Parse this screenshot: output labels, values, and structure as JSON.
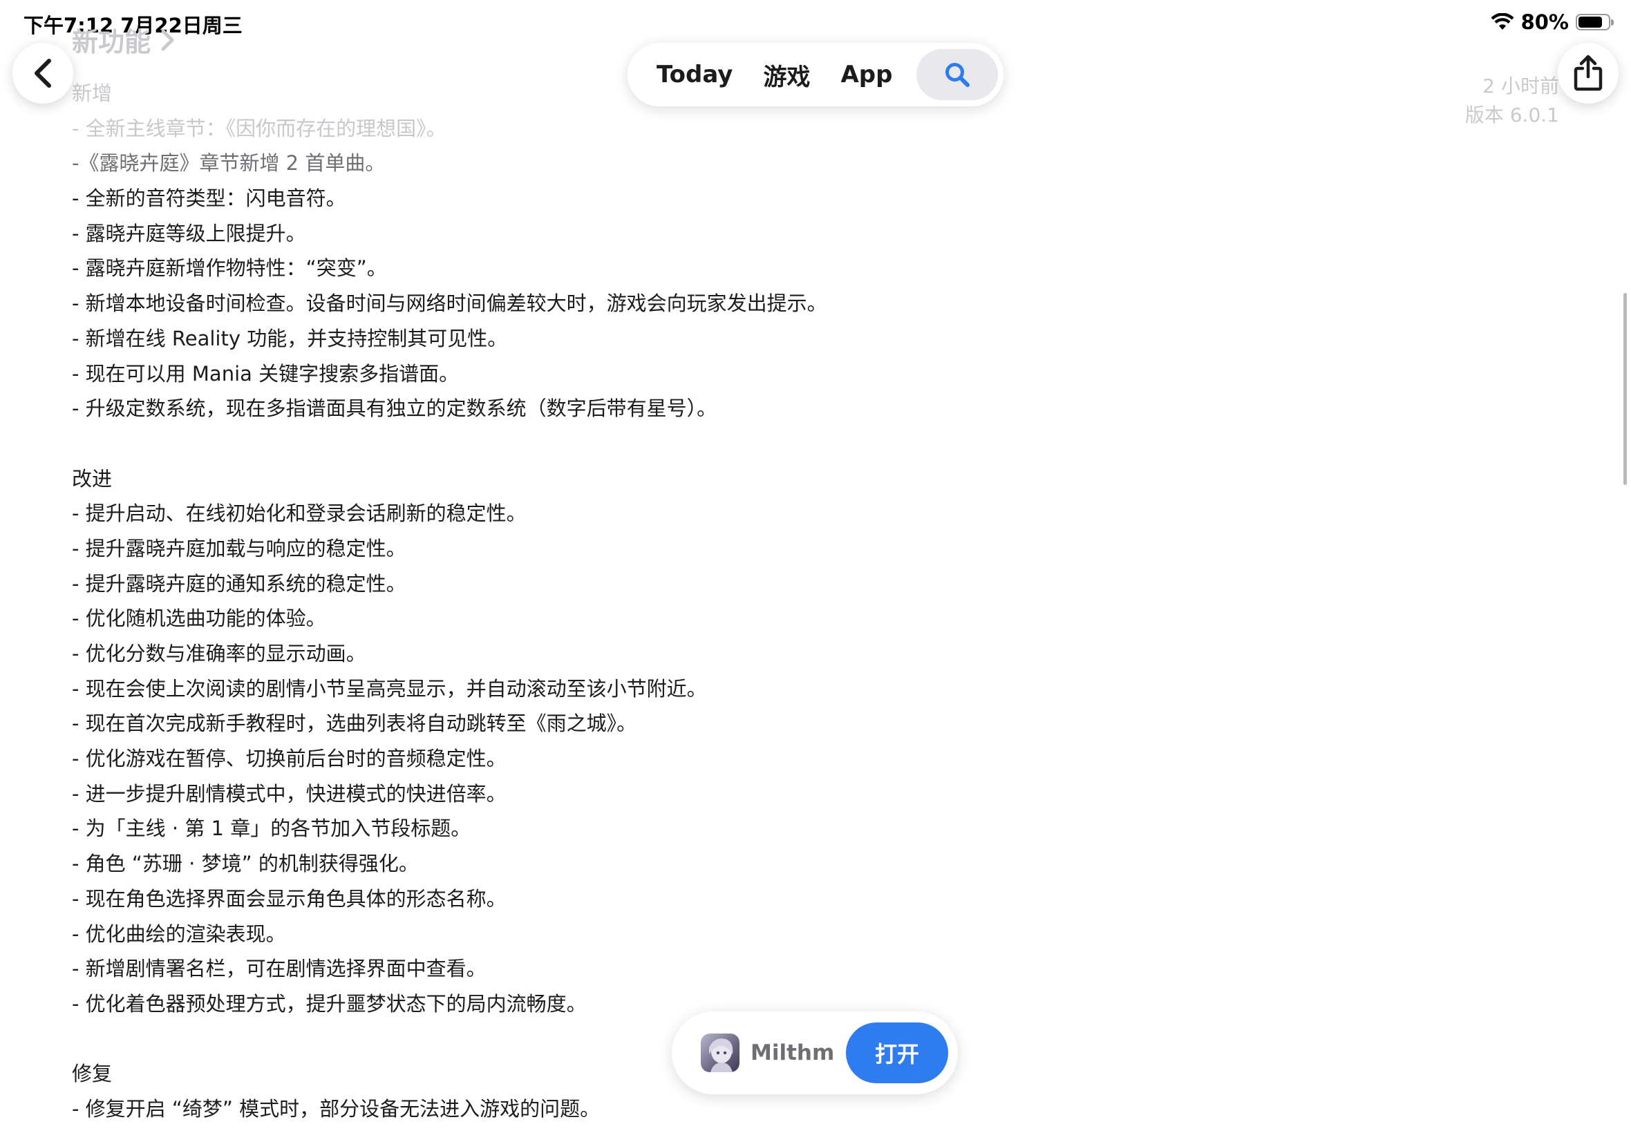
{
  "status_bar": {
    "time_date": "下午7:12   7月22日周三",
    "battery": "80%",
    "battery_level": 0.8
  },
  "header": {
    "section_title": "新功能",
    "time_ago": "2 小时前",
    "version": "版本 6.0.1"
  },
  "nav": {
    "tabs": [
      "Today",
      "游戏",
      "App"
    ]
  },
  "release_notes": {
    "added_heading": "新增",
    "added": [
      "- 全新主线章节：《因你而存在的理想国》。",
      "-《露晓卉庭》章节新增 2 首单曲。",
      "- 全新的音符类型：闪电音符。",
      "- 露晓卉庭等级上限提升。",
      "- 露晓卉庭新增作物特性：“突变”。",
      "- 新增本地设备时间检查。设备时间与网络时间偏差较大时，游戏会向玩家发出提示。",
      "- 新增在线 Reality 功能，并支持控制其可见性。",
      "- 现在可以用 Mania 关键字搜索多指谱面。",
      "- 升级定数系统，现在多指谱面具有独立的定数系统（数字后带有星号）。"
    ],
    "improved_heading": "改进",
    "improved": [
      "- 提升启动、在线初始化和登录会话刷新的稳定性。",
      "- 提升露晓卉庭加载与响应的稳定性。",
      "- 提升露晓卉庭的通知系统的稳定性。",
      "- 优化随机选曲功能的体验。",
      "- 优化分数与准确率的显示动画。",
      "- 现在会使上次阅读的剧情小节呈高亮显示，并自动滚动至该小节附近。",
      "- 现在首次完成新手教程时，选曲列表将自动跳转至《雨之城》。",
      "- 优化游戏在暂停、切换前后台时的音频稳定性。",
      "- 进一步提升剧情模式中，快进模式的快进倍率。",
      "- 为「主线 · 第 1 章」的各节加入节段标题。",
      "- 角色 “苏珊 · 梦境” 的机制获得强化。",
      "- 现在角色选择界面会显示角色具体的形态名称。",
      "- 优化曲绘的渲染表现。",
      "- 新增剧情署名栏，可在剧情选择界面中查看。",
      "- 优化着色器预处理方式，提升噩梦状态下的局内流畅度。"
    ],
    "fixed_heading": "修复",
    "fixed": [
      "- 修复开启 “绮梦” 模式时，部分设备无法进入游戏的问题。"
    ]
  },
  "app_banner": {
    "name": "Milthm",
    "open_label": "打开"
  },
  "colors": {
    "accent": "#2f7cf0",
    "faded_text": "#c7c7cc"
  }
}
